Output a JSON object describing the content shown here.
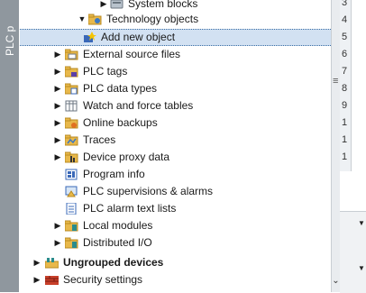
{
  "side_strip_label": "PLC p",
  "tree": {
    "rows": [
      {
        "label": "System blocks",
        "icon": "system-blocks-icon",
        "toggle": "collapsed"
      },
      {
        "label": "Technology objects",
        "icon": "technology-objects-icon",
        "toggle": "expanded"
      },
      {
        "label": "Add new object",
        "icon": "add-new-object-icon",
        "toggle": "none",
        "selected": true
      },
      {
        "label": "External source files",
        "icon": "folder-icon",
        "toggle": "collapsed"
      },
      {
        "label": "PLC tags",
        "icon": "plc-tags-icon",
        "toggle": "collapsed"
      },
      {
        "label": "PLC data types",
        "icon": "plc-data-types-icon",
        "toggle": "collapsed"
      },
      {
        "label": "Watch and force tables",
        "icon": "watch-tables-icon",
        "toggle": "collapsed"
      },
      {
        "label": "Online backups",
        "icon": "online-backups-icon",
        "toggle": "collapsed"
      },
      {
        "label": "Traces",
        "icon": "traces-icon",
        "toggle": "collapsed"
      },
      {
        "label": "Device proxy data",
        "icon": "device-proxy-icon",
        "toggle": "collapsed"
      },
      {
        "label": "Program info",
        "icon": "program-info-icon",
        "toggle": "none"
      },
      {
        "label": "PLC supervisions & alarms",
        "icon": "plc-supervisions-icon",
        "toggle": "none"
      },
      {
        "label": "PLC alarm text lists",
        "icon": "alarm-text-lists-icon",
        "toggle": "none"
      },
      {
        "label": "Local modules",
        "icon": "local-modules-icon",
        "toggle": "collapsed"
      },
      {
        "label": "Distributed I/O",
        "icon": "distributed-io-icon",
        "toggle": "collapsed"
      },
      {
        "label": "Ungrouped devices",
        "icon": "ungrouped-devices-icon",
        "toggle": "collapsed",
        "bold": true
      },
      {
        "label": "Security settings",
        "icon": "security-settings-icon",
        "toggle": "collapsed"
      }
    ]
  },
  "right_panel": {
    "row_numbers": [
      "3",
      "4",
      "5",
      "6",
      "7",
      "8",
      "9",
      "1",
      "1",
      "1"
    ]
  },
  "colors": {
    "selection": "#d2e1f2",
    "side_strip": "#8f979e",
    "folder": "#e8b84a"
  }
}
